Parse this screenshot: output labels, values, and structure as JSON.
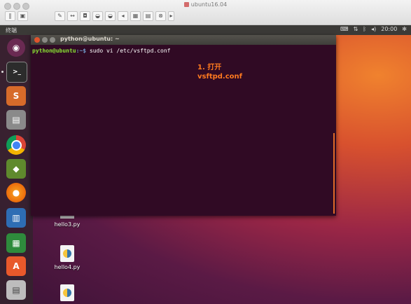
{
  "host_window": {
    "title": "ubuntu16.04"
  },
  "top_panel": {
    "app_name": "终端",
    "clock": "20:00"
  },
  "terminal": {
    "title": "python@ubuntu: ~",
    "prompt_user": "python@ubuntu",
    "prompt_path": ":~$",
    "command": " sudo vi /etc/vsftpd.conf"
  },
  "annotation": {
    "line1": "1. 打开",
    "line2": "vsftpd.conf"
  },
  "desktop_icons": [
    {
      "label": "hello3.py"
    },
    {
      "label": "hello4.py"
    }
  ],
  "colors": {
    "terminal_bg": "#300a24",
    "prompt_user": "#8ae234",
    "prompt_path": "#729fcf",
    "annotation": "#ff7a1f"
  }
}
